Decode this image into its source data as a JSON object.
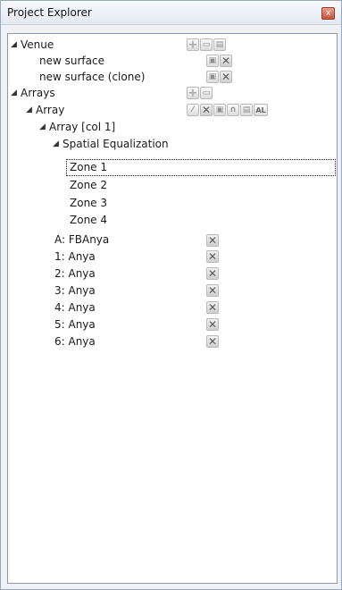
{
  "window": {
    "title": "Project Explorer",
    "close_glyph": "x"
  },
  "tree": {
    "venue": {
      "label": "Venue",
      "actions": [
        "add-icon",
        "edit-icon",
        "save-icon"
      ],
      "children": [
        {
          "label": "new surface",
          "actions": [
            "copy-icon",
            "delete-icon"
          ]
        },
        {
          "label": "new surface (clone)",
          "actions": [
            "copy-icon",
            "delete-icon"
          ]
        }
      ]
    },
    "arrays": {
      "label": "Arrays",
      "actions": [
        "add-icon",
        "edit-icon"
      ],
      "array": {
        "label": "Array",
        "actions": [
          "pencil-icon",
          "delete-icon",
          "copy-icon",
          "headphones-icon",
          "save-icon",
          "al-icon"
        ],
        "al_label": "AL",
        "column": {
          "label": "Array [col 1]",
          "spatial_eq": {
            "label": "Spatial Equalization",
            "zones": [
              "Zone 1",
              "Zone 2",
              "Zone 3",
              "Zone 4"
            ],
            "selected_zone": "Zone 1"
          }
        },
        "elements": [
          {
            "label": "A: FBAnya"
          },
          {
            "label": "1: Anya"
          },
          {
            "label": "2: Anya"
          },
          {
            "label": "3: Anya"
          },
          {
            "label": "4: Anya"
          },
          {
            "label": "5: Anya"
          },
          {
            "label": "6: Anya"
          }
        ]
      }
    }
  }
}
